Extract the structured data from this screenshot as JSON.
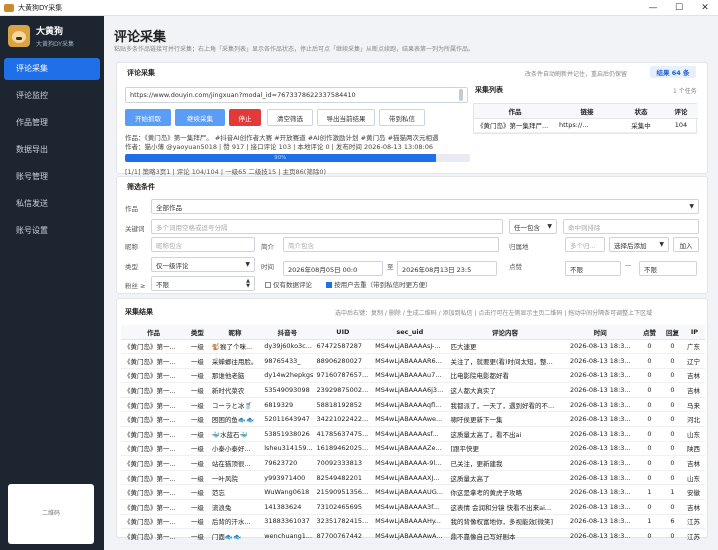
{
  "window": {
    "title": "大黄狗DY采集",
    "min": "—",
    "max": "☐",
    "close": "✕"
  },
  "sidebar": {
    "user_name": "大黄狗",
    "user_sub": "大黄狗DY采集",
    "items": [
      {
        "label": "评论采集"
      },
      {
        "label": "评论监控"
      },
      {
        "label": "作品管理"
      },
      {
        "label": "数据导出"
      },
      {
        "label": "账号管理"
      },
      {
        "label": "私信发送"
      },
      {
        "label": "账号设置"
      }
    ],
    "qr_label": "二维码"
  },
  "page": {
    "title": "评论采集",
    "desc": "粘贴多条作品链接可并行采集；右上角「采集列表」显示各作品状态，停止后可点「继续采集」从断点续跑，结果表第一列为所属作品。"
  },
  "collect": {
    "section": "评论采集",
    "auto_note": "改条件自动刷新并记住，重启后仍保留",
    "result_badge": "结果 64 条",
    "url_value": "https://www.douyin.com/jingxuan?modal_id=7673378622337584410",
    "buttons": {
      "start": "开始抓取",
      "continue": "继续采集",
      "stop": "停止",
      "clear": "清空筛选",
      "export": "导出当前结果",
      "dm": "带到私信"
    },
    "info_line1": "作品：《黄门岛》第一集拜尸。 #抖音AI创作者大赛 #开放赛道 #AI创作激励计划 #黄门岛 #猫猫两次元相遇",
    "info_line2": "作者：猫小薄 @yaoyuan5018 | 赞 917 | 接口评论 103 | 本地评论 0 | 发布时间 2026-08-13 13:08:06",
    "progress_text": "90%",
    "progress_value": 0.9,
    "stats_line": "[1/1] 策略3页1 | 评论 104/104 | 一级65 二级技15 | 主页86(筛除0)"
  },
  "task_list": {
    "title": "采集列表",
    "count": "1 个任务",
    "headers": [
      "作品",
      "链接",
      "状态",
      "评论"
    ],
    "rows": [
      [
        "《黄门岛》第一集拜尸...",
        "https://...",
        "采集中",
        "104"
      ]
    ]
  },
  "filters": {
    "section": "筛选条件",
    "work_label": "作品",
    "work_value": "全部作品",
    "keyword_label": "关键词",
    "keyword_placeholder": "多个词用空格或逗号分隔",
    "contains_value": "任一包含",
    "exclude_placeholder": "命中则排除",
    "nickname_label": "昵称",
    "nickname_placeholder": "昵称包含",
    "intro_label": "简介",
    "intro_placeholder": "简介包含",
    "region_label": "归属地",
    "region_placeholder": "多个归...",
    "region_select": "选择后添加",
    "add_btn": "加入",
    "type_label": "类型",
    "type_value": "仅一级评论",
    "time_label": "时间",
    "time_start": "2026年08月05日 00:0",
    "time_sep": "至",
    "time_end": "2026年08月13日 23:5",
    "likes_label": "点赞",
    "likes_min": "不限",
    "likes_dash": "—",
    "likes_max": "不限",
    "fans_label": "粉丝 ≥",
    "fans_value": "不限",
    "check1": "仅有数据评论",
    "check2": "按用户去重（带到私信时更方便）"
  },
  "results": {
    "section": "采集结果",
    "hint": "选中后右键：复制 / 删除 / 生成二维码 / 添加到私信 | 点击行可在左侧显示主页二维码 | 拖动中间分隔条可调整上下区域",
    "headers": [
      "作品",
      "类型",
      "昵称",
      "抖音号",
      "UID",
      "sec_uid",
      "评论内容",
      "时间",
      "点赞",
      "回复",
      "IP"
    ],
    "rows": [
      [
        "《黄门岛》第一...",
        "一级",
        "🐒猴了个咪...",
        "dy39j60ko3c...",
        "67472587287",
        "MS4wLjABAAAAsJ-...",
        "匹大速更",
        "2026-08-13 18:3...",
        "0",
        "0",
        "广东"
      ],
      [
        "《黄门岛》第一...",
        "一级",
        "采蝉螂往用脸。",
        "98765433_",
        "88906280027",
        "MS4wLjABAAAAR6...",
        "关注了，就要更(看)时间太短，整...",
        "2026-08-13 18:3...",
        "0",
        "0",
        "辽宁"
      ],
      [
        "《黄门岛》第一...",
        "一级",
        "那谁他老脑",
        "dy14w2hepkgs",
        "97160787657...",
        "MS4wLjABAAAAu7...",
        "比电影院电影都好看",
        "2026-08-13 18:3...",
        "0",
        "0",
        "吉林"
      ],
      [
        "《黄门岛》第一...",
        "一级",
        "新时代菜农",
        "53549093098",
        "23929875002...",
        "MS4wLjABAAAA6j3...",
        "这人都大真实了",
        "2026-08-13 18:3...",
        "0",
        "0",
        "吉林"
      ],
      [
        "《黄门岛》第一...",
        "一级",
        "コーラと冰🥤",
        "6819329",
        "58818192852",
        "MS4wLjABAAAAqfl...",
        "我都派了，一天了，遇到好看的不...",
        "2026-08-13 18:3...",
        "0",
        "0",
        "马来"
      ],
      [
        "《黄门岛》第一...",
        "一级",
        "困困的鱼🐟🐟",
        "52011643947",
        "34221022422...",
        "MS4wLjABAAAAwe...",
        "啸吁侯更新下一集",
        "2026-08-13 18:3...",
        "0",
        "0",
        "河北"
      ],
      [
        "《黄门岛》第一...",
        "一级",
        "🐳水蓝石🐳",
        "53851938026",
        "41785637475...",
        "MS4wLjABAAAAsf...",
        "这质量太高了，看不出ai",
        "2026-08-13 18:3...",
        "0",
        "0",
        "山东"
      ],
      [
        "《黄门岛》第一...",
        "一级",
        "小泰小泰好...",
        "lsheu314159...",
        "16189462025...",
        "MS4wLjABAAAAZe...",
        "[跟平快更",
        "2026-08-13 18:3...",
        "0",
        "0",
        "陕西"
      ],
      [
        "《黄门岛》第一...",
        "一级",
        "站在猫顶很...",
        "79623720",
        "70092333813",
        "MS4wLjABAAAA-9l...",
        "已关注，更新建我",
        "2026-08-13 18:3...",
        "0",
        "0",
        "吉林"
      ],
      [
        "《黄门岛》第一...",
        "一级",
        "一叶风院",
        "y993971400",
        "82549482201",
        "MS4wLjABAAAAXJ...",
        "这质量太高了",
        "2026-08-13 18:3...",
        "0",
        "0",
        "山东"
      ],
      [
        "《黄门岛》第一...",
        "一级",
        "范忘",
        "WuWang0618",
        "21590951356...",
        "MS4wLjABAAAAUG...",
        "你这是拿考的黄虎子攻略",
        "2026-08-13 18:3...",
        "1",
        "1",
        "安徽"
      ],
      [
        "《黄门岛》第一...",
        "一级",
        "流浪兔",
        "141383624",
        "73102465695",
        "MS4wLjABAAAA3f...",
        "这表情 会润和分镜 快看不出来ai...",
        "2026-08-13 18:3...",
        "0",
        "0",
        "吉林"
      ],
      [
        "《黄门岛》第一...",
        "一级",
        "后背的汗水...",
        "31883361037",
        "32351782415...",
        "MS4wLjABAAAAHy...",
        "我的背像权富地你，多视能效[微笑]",
        "2026-08-13 18:3...",
        "1",
        "6",
        "江苏"
      ],
      [
        "《黄门岛》第一...",
        "一级",
        "门面🐟🐟",
        "wenchuang1...",
        "87700767442",
        "MS4wLjABAAAAwA...",
        "鼎不靠像自己写好剧本",
        "2026-08-13 18:3...",
        "0",
        "0",
        "江苏"
      ]
    ]
  }
}
